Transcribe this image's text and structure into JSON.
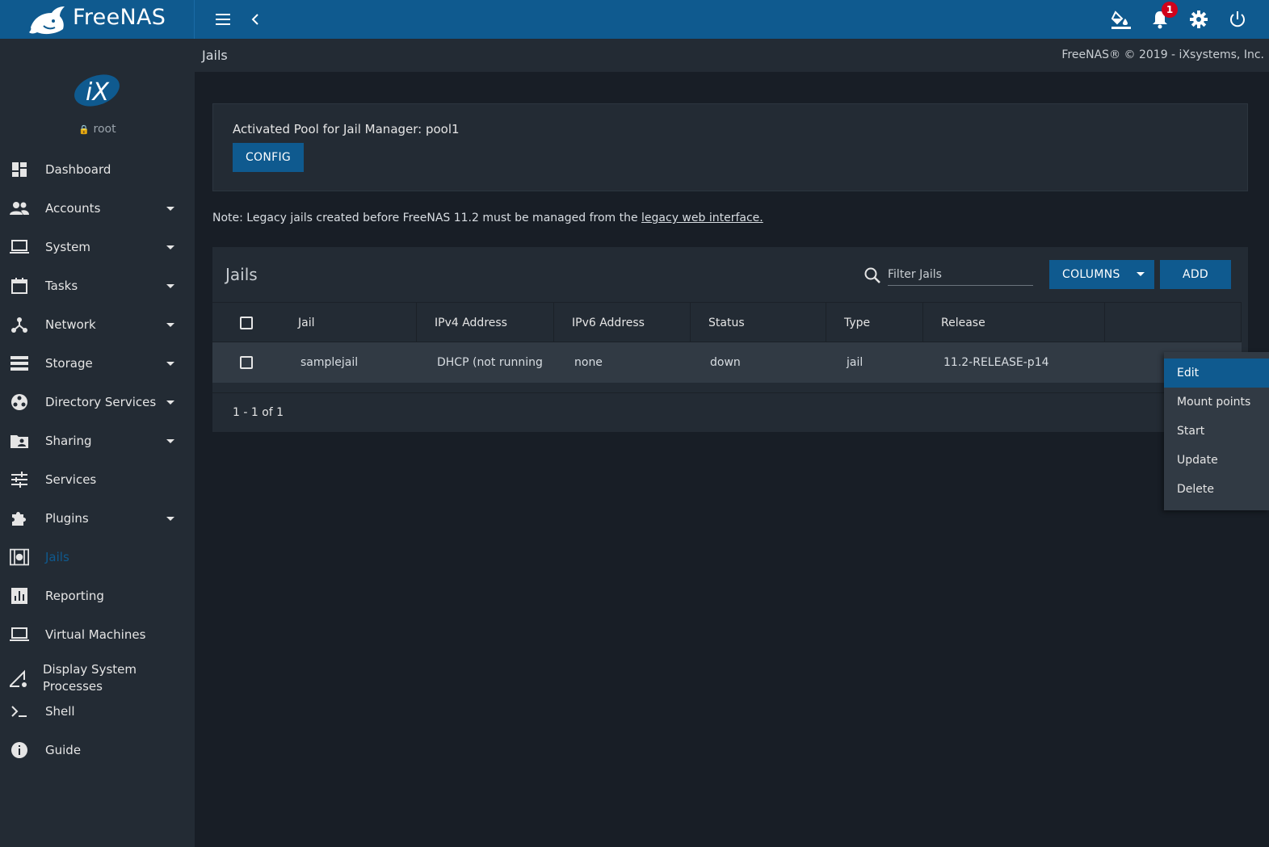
{
  "app": {
    "brand": "FreeNAS",
    "user": "root"
  },
  "topbar": {
    "notifications_count": "1",
    "icons": [
      "menu-icon",
      "chevron-left-icon",
      "theme-paint-icon",
      "bell-icon",
      "gear-icon",
      "power-icon"
    ]
  },
  "sidebar": {
    "items": [
      {
        "label": "Dashboard",
        "icon": "dashboard-icon",
        "has_caret": false
      },
      {
        "label": "Accounts",
        "icon": "people-icon",
        "has_caret": true
      },
      {
        "label": "System",
        "icon": "laptop-icon",
        "has_caret": true
      },
      {
        "label": "Tasks",
        "icon": "calendar-icon",
        "has_caret": true
      },
      {
        "label": "Network",
        "icon": "network-icon",
        "has_caret": true
      },
      {
        "label": "Storage",
        "icon": "storage-icon",
        "has_caret": true
      },
      {
        "label": "Directory Services",
        "icon": "directory-icon",
        "has_caret": true
      },
      {
        "label": "Sharing",
        "icon": "folder-shared-icon",
        "has_caret": true
      },
      {
        "label": "Services",
        "icon": "sliders-icon",
        "has_caret": false
      },
      {
        "label": "Plugins",
        "icon": "puzzle-icon",
        "has_caret": true
      },
      {
        "label": "Jails",
        "icon": "jail-icon",
        "has_caret": false,
        "active": true
      },
      {
        "label": "Reporting",
        "icon": "chart-icon",
        "has_caret": false
      },
      {
        "label": "Virtual Machines",
        "icon": "monitor-icon",
        "has_caret": false
      },
      {
        "label": "Display System Processes",
        "icon": "processes-icon",
        "has_caret": false
      },
      {
        "label": "Shell",
        "icon": "terminal-icon",
        "has_caret": false
      },
      {
        "label": "Guide",
        "icon": "info-icon",
        "has_caret": false
      }
    ]
  },
  "page": {
    "title": "Jails",
    "copyright": "FreeNAS® © 2019 - iXsystems, Inc."
  },
  "pool": {
    "label": "Activated Pool for Jail Manager: pool1",
    "config_label": "CONFIG"
  },
  "note": {
    "text": "Note: Legacy jails created before FreeNAS 11.2 must be managed from the ",
    "link": "legacy web interface."
  },
  "jails_table": {
    "title": "Jails",
    "filter_placeholder": "Filter Jails",
    "columns_label": "COLUMNS",
    "add_label": "ADD",
    "headers": [
      "Jail",
      "IPv4 Address",
      "IPv6 Address",
      "Status",
      "Type",
      "Release"
    ],
    "rows": [
      {
        "jail": "samplejail",
        "ipv4": "DHCP (not running",
        "ipv6": "none",
        "status": "down",
        "type": "jail",
        "release": "11.2-RELEASE-p14"
      }
    ],
    "range": "1 - 1 of 1"
  },
  "context_menu": {
    "items": [
      "Edit",
      "Mount points",
      "Start",
      "Update",
      "Delete"
    ],
    "selected": "Edit"
  },
  "colors": {
    "accent": "#0f5a8f",
    "sidebar_bg": "#232b34",
    "page_bg": "#181e26",
    "badge": "#d0021b"
  }
}
